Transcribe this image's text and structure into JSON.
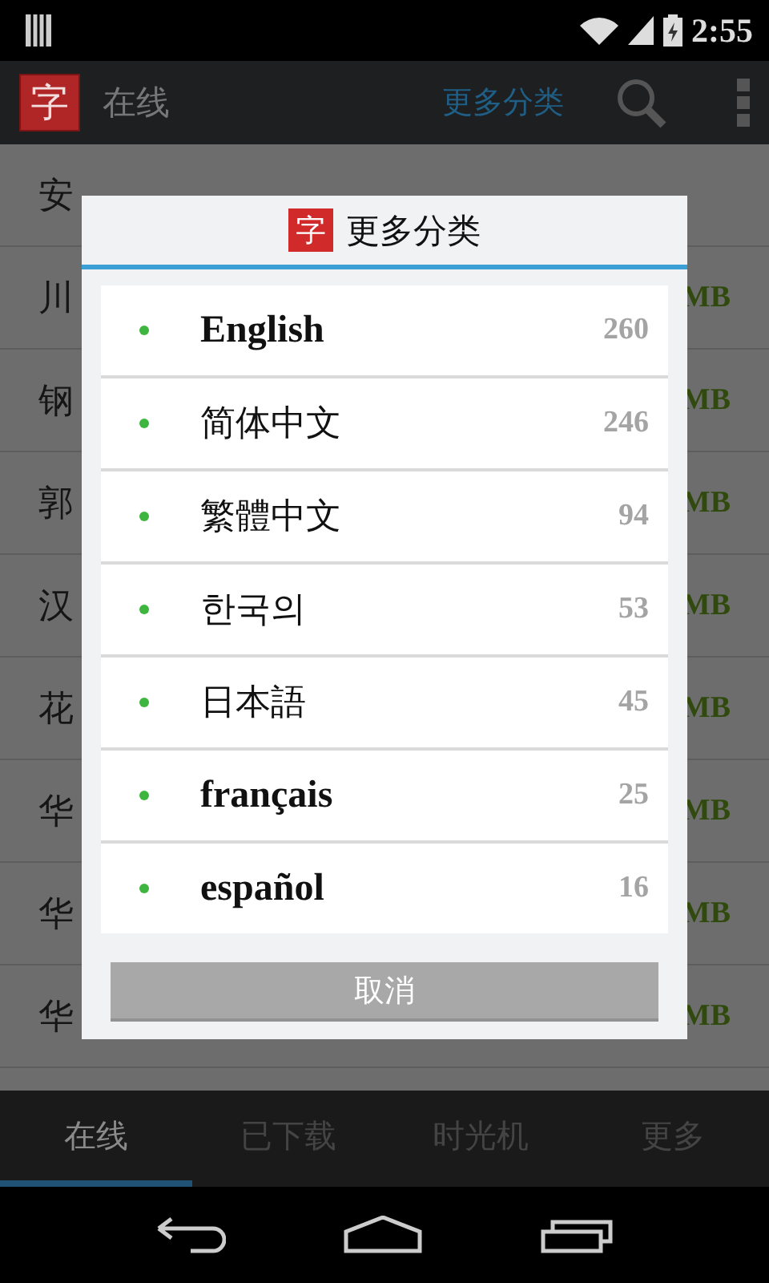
{
  "status_bar": {
    "time": "2:55"
  },
  "action_bar": {
    "logo": "字",
    "title": "在线",
    "link": "更多分类"
  },
  "fonts": [
    {
      "name": "安"
    },
    {
      "name": "川",
      "size": "MB"
    },
    {
      "name": "钢",
      "size": "MB"
    },
    {
      "name": "郭",
      "size": "MB"
    },
    {
      "name": "汉",
      "size": "MB"
    },
    {
      "name": "花",
      "size": "MB"
    },
    {
      "name": "华",
      "size": "MB"
    },
    {
      "name": "华",
      "size": "MB"
    },
    {
      "name": "华",
      "size": "MB"
    }
  ],
  "dialog": {
    "icon": "字",
    "title": "更多分类",
    "categories": [
      {
        "name": "English",
        "count": "260",
        "kind": "latin"
      },
      {
        "name": "简体中文",
        "count": "246",
        "kind": "cjk"
      },
      {
        "name": "繁體中文",
        "count": "94",
        "kind": "cjk"
      },
      {
        "name": "한국의",
        "count": "53",
        "kind": "cjk"
      },
      {
        "name": "日本語",
        "count": "45",
        "kind": "cjk"
      },
      {
        "name": "français",
        "count": "25",
        "kind": "latin"
      },
      {
        "name": "español",
        "count": "16",
        "kind": "latin"
      }
    ],
    "cancel": "取消"
  },
  "tabs": [
    {
      "label": "在线",
      "selected": true
    },
    {
      "label": "已下载",
      "selected": false
    },
    {
      "label": "时光机",
      "selected": false
    },
    {
      "label": "更多",
      "selected": false
    }
  ]
}
